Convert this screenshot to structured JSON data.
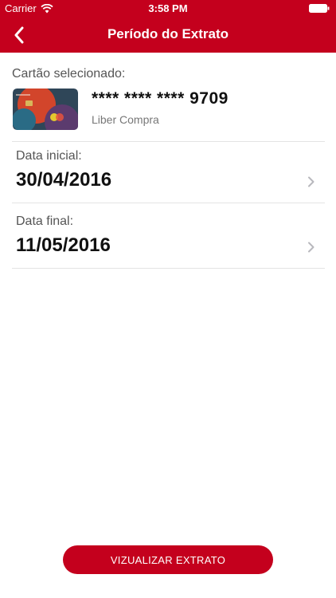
{
  "status_bar": {
    "carrier": "Carrier",
    "time": "3:58 PM"
  },
  "nav": {
    "title": "Período do Extrato"
  },
  "card": {
    "label": "Cartão selecionado:",
    "number_masked": "**** **** ****",
    "number_last4": "9709",
    "type": "Liber Compra"
  },
  "start_date": {
    "label": "Data inicial:",
    "value": "30/04/2016"
  },
  "end_date": {
    "label": "Data final:",
    "value": "11/05/2016"
  },
  "action": {
    "label": "VIZUALIZAR EXTRATO"
  },
  "colors": {
    "brand_red": "#c4001d",
    "divider": "#e4e4e4"
  }
}
